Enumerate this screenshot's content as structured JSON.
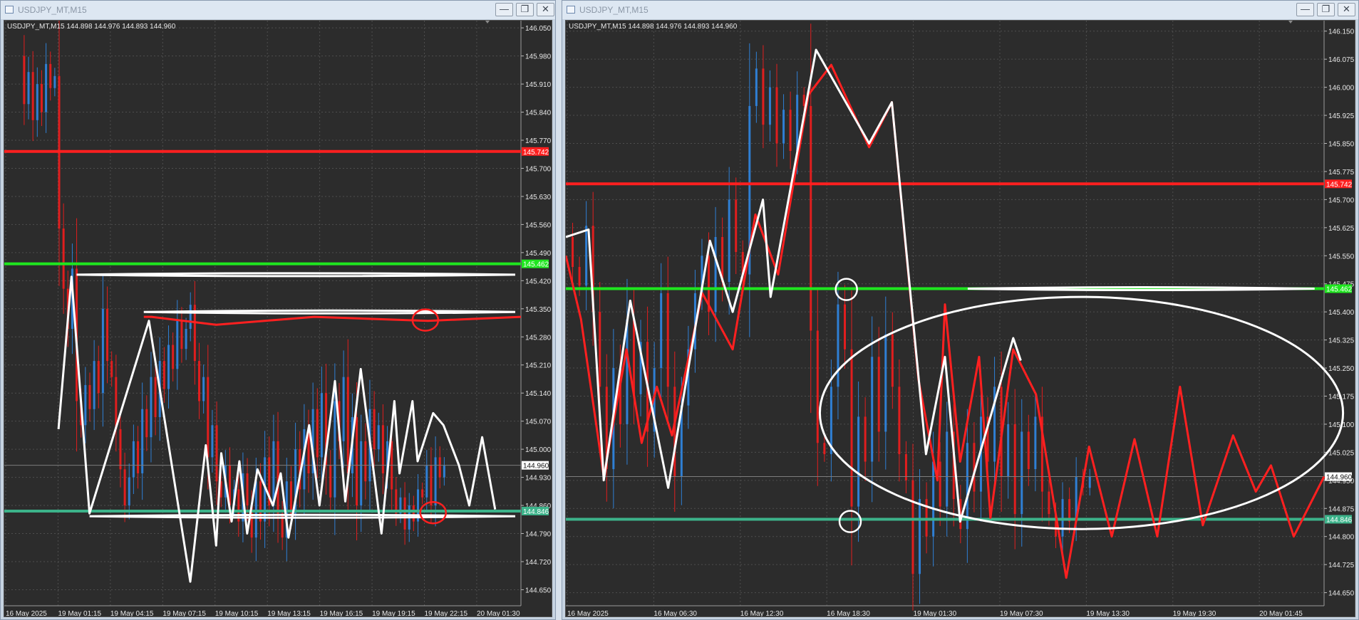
{
  "windows": [
    {
      "title": "USDJPY_MT,M15",
      "info": "USDJPY_MT,M15  144.898 144.976 144.893 144.960",
      "minimize": "—",
      "restore": "❐",
      "close": "✕",
      "chart_data": {
        "type": "candlestick",
        "ylim": [
          144.61,
          146.068
        ],
        "yticks": [
          "146.050",
          "145.980",
          "145.910",
          "145.840",
          "145.770",
          "145.700",
          "145.630",
          "145.560",
          "145.490",
          "145.420",
          "145.350",
          "145.280",
          "145.210",
          "145.140",
          "145.070",
          "145.000",
          "144.930",
          "144.860",
          "144.790",
          "144.720",
          "144.650"
        ],
        "xticks": [
          "16 May 2025",
          "19 May 01:15",
          "19 May 04:15",
          "19 May 07:15",
          "19 May 10:15",
          "19 May 13:15",
          "19 May 16:15",
          "19 May 19:15",
          "19 May 22:15",
          "20 May 01:30"
        ],
        "hlines": [
          {
            "price": 145.742,
            "label": "145.742",
            "color": "#ff1f1f"
          },
          {
            "price": 145.462,
            "label": "145.462",
            "color": "#1fe61f"
          },
          {
            "price": 144.846,
            "label": "144.846",
            "color": "#3cb38a"
          }
        ],
        "current": {
          "price": 144.96,
          "label": "144.960"
        },
        "price_path": [
          145.98,
          145.86,
          145.94,
          145.82,
          145.91,
          145.84,
          145.96,
          145.9,
          145.93,
          145.55,
          145.4,
          145.3,
          145.45,
          145.12,
          145.06,
          145.16,
          145.1,
          145.22,
          145.14,
          145.35,
          145.22,
          145.18,
          145.05,
          144.95,
          144.86,
          144.93,
          145.02,
          144.94,
          145.1,
          145.03,
          145.18,
          145.08,
          145.22,
          145.15,
          145.26,
          145.2,
          145.32,
          145.25,
          145.3,
          145.36,
          145.22,
          145.12,
          145.18,
          144.98,
          145.06,
          144.92,
          144.88,
          144.96,
          144.86,
          144.9,
          144.82,
          144.94,
          144.86,
          144.78,
          144.92,
          144.82,
          144.98,
          144.86,
          145.02,
          144.84,
          144.78,
          144.92,
          144.84,
          145.0,
          144.9,
          145.05,
          144.94,
          145.1,
          144.98,
          145.14,
          144.96,
          144.88,
          145.12,
          145.02,
          145.18,
          144.94,
          145.08,
          144.86,
          145.02,
          144.92,
          145.1,
          145.0,
          145.06,
          144.94,
          145.02,
          144.9,
          144.84,
          144.88,
          144.8,
          144.86,
          144.82,
          144.9,
          144.88,
          144.96,
          144.86,
          144.98,
          144.93,
          144.96
        ],
        "candle_span": [
          0.03,
          0.86
        ],
        "drawings": {
          "zigzag": [
            [
              0.105,
              145.05
            ],
            [
              0.13,
              145.43
            ],
            [
              0.165,
              144.84
            ],
            [
              0.28,
              145.32
            ],
            [
              0.36,
              144.67
            ],
            [
              0.39,
              145.01
            ],
            [
              0.41,
              144.76
            ],
            [
              0.42,
              144.99
            ],
            [
              0.44,
              144.82
            ],
            [
              0.455,
              144.97
            ],
            [
              0.47,
              144.79
            ],
            [
              0.49,
              144.95
            ],
            [
              0.52,
              144.86
            ],
            [
              0.535,
              144.94
            ],
            [
              0.55,
              144.78
            ],
            [
              0.59,
              145.06
            ],
            [
              0.61,
              144.86
            ],
            [
              0.64,
              145.17
            ],
            [
              0.66,
              144.87
            ],
            [
              0.69,
              145.2
            ],
            [
              0.73,
              144.79
            ],
            [
              0.755,
              145.12
            ],
            [
              0.765,
              144.94
            ],
            [
              0.79,
              145.12
            ],
            [
              0.8,
              144.97
            ],
            [
              0.83,
              145.09
            ],
            [
              0.85,
              145.06
            ],
            [
              0.88,
              144.96
            ],
            [
              0.9,
              144.86
            ],
            [
              0.925,
              145.03
            ],
            [
              0.95,
              144.85
            ]
          ],
          "zigzag_red": [
            [
              0.27,
              145.33
            ],
            [
              0.285,
              145.33
            ],
            [
              0.41,
              145.31
            ],
            [
              0.6,
              145.33
            ],
            [
              0.82,
              145.32
            ],
            [
              1.0,
              145.33
            ]
          ],
          "white_bands": [
            [
              0.14,
              145.435,
              1.0
            ],
            [
              0.27,
              145.342,
              1.0
            ],
            [
              0.165,
              144.833,
              1.0
            ]
          ],
          "red_circles": [
            [
              0.815,
              145.322
            ],
            [
              0.83,
              144.842
            ]
          ]
        }
      }
    },
    {
      "title": "USDJPY_MT,M15",
      "info": "USDJPY_MT,M15  144.898 144.976 144.893 144.960",
      "minimize": "—",
      "restore": "❐",
      "close": "✕",
      "chart_data": {
        "type": "candlestick",
        "ylim": [
          144.615,
          146.178
        ],
        "yticks": [
          "146.150",
          "146.075",
          "146.000",
          "145.925",
          "145.850",
          "145.775",
          "145.700",
          "145.625",
          "145.550",
          "145.475",
          "145.400",
          "145.325",
          "145.250",
          "145.175",
          "145.100",
          "145.025",
          "144.950",
          "144.875",
          "144.800",
          "144.725",
          "144.650"
        ],
        "xticks": [
          "16 May 2025",
          "16 May 06:30",
          "16 May 12:30",
          "16 May 18:30",
          "19 May 01:30",
          "19 May 07:30",
          "19 May 13:30",
          "19 May 19:30",
          "20 May 01:45"
        ],
        "hlines": [
          {
            "price": 145.742,
            "label": "145.742",
            "color": "#ff1f1f"
          },
          {
            "price": 145.462,
            "label": "145.462",
            "color": "#1fe61f"
          },
          {
            "price": 144.846,
            "label": "144.846",
            "color": "#3cb38a"
          }
        ],
        "current": {
          "price": 144.96,
          "label": "144.960"
        },
        "price_path": [
          145.6,
          145.52,
          145.47,
          145.63,
          145.4,
          145.2,
          144.98,
          145.25,
          145.1,
          145.38,
          145.18,
          145.32,
          145.08,
          145.25,
          145.45,
          145.2,
          144.96,
          145.15,
          145.3,
          145.45,
          145.55,
          145.4,
          145.6,
          145.48,
          145.7,
          145.56,
          145.5,
          145.95,
          146.05,
          145.9,
          146.0,
          145.85,
          145.94,
          145.83,
          145.98,
          145.95,
          145.35,
          145.05,
          145.02,
          145.2,
          145.42,
          145.3,
          144.88,
          145.12,
          145.0,
          145.28,
          145.08,
          145.34,
          145.2,
          145.02,
          144.95,
          144.7,
          144.9,
          144.8,
          145.0,
          144.88,
          145.08,
          144.9,
          144.82,
          145.05,
          144.92,
          145.12,
          145.0,
          145.2,
          144.96,
          145.1,
          144.86,
          145.08,
          144.98,
          145.12,
          144.92,
          144.86,
          144.8,
          144.9,
          144.84,
          144.96,
          144.93,
          144.96
        ],
        "candle_span": [
          0.0,
          0.7
        ],
        "drawings": {
          "zigzag": [
            [
              0.0,
              145.6
            ],
            [
              0.03,
              145.62
            ],
            [
              0.05,
              144.95
            ],
            [
              0.085,
              145.43
            ],
            [
              0.135,
              144.93
            ],
            [
              0.19,
              145.59
            ],
            [
              0.22,
              145.4
            ],
            [
              0.26,
              145.7
            ],
            [
              0.27,
              145.44
            ],
            [
              0.33,
              146.1
            ],
            [
              0.4,
              145.85
            ],
            [
              0.43,
              145.96
            ],
            [
              0.475,
              145.02
            ],
            [
              0.5,
              145.28
            ],
            [
              0.52,
              144.84
            ],
            [
              0.59,
              145.33
            ],
            [
              0.6,
              145.27
            ]
          ],
          "zigzag_red": [
            [
              0.0,
              145.55
            ],
            [
              0.02,
              145.38
            ],
            [
              0.05,
              144.96
            ],
            [
              0.08,
              145.3
            ],
            [
              0.1,
              145.05
            ],
            [
              0.12,
              145.2
            ],
            [
              0.14,
              145.07
            ],
            [
              0.18,
              145.45
            ],
            [
              0.22,
              145.3
            ],
            [
              0.25,
              145.66
            ],
            [
              0.28,
              145.5
            ],
            [
              0.32,
              145.98
            ],
            [
              0.35,
              146.06
            ],
            [
              0.4,
              145.84
            ],
            [
              0.43,
              145.96
            ],
            [
              0.465,
              145.22
            ],
            [
              0.49,
              144.95
            ],
            [
              0.5,
              145.42
            ],
            [
              0.52,
              145.0
            ],
            [
              0.545,
              145.28
            ],
            [
              0.56,
              144.85
            ],
            [
              0.59,
              145.3
            ],
            [
              0.62,
              145.18
            ],
            [
              0.66,
              144.69
            ],
            [
              0.69,
              145.04
            ],
            [
              0.72,
              144.8
            ],
            [
              0.75,
              145.06
            ],
            [
              0.78,
              144.8
            ],
            [
              0.81,
              145.2
            ],
            [
              0.84,
              144.83
            ],
            [
              0.88,
              145.07
            ],
            [
              0.91,
              144.92
            ],
            [
              0.93,
              144.99
            ],
            [
              0.96,
              144.8
            ],
            [
              1.0,
              144.96
            ]
          ],
          "white_bands": [
            [
              0.53,
              145.462,
              0.995
            ]
          ],
          "white_circles": [
            [
              0.37,
              145.46
            ],
            [
              0.375,
              144.84
            ]
          ],
          "ellipse": {
            "cx": 0.68,
            "cy": 145.13,
            "rx": 0.345,
            "ry_price": 0.31
          }
        }
      }
    }
  ],
  "colors": {
    "bull": "#2f7fd4",
    "bear": "#e01e1e",
    "grid": "#4e4e4e",
    "axis_text": "#e8e8e8",
    "bg": "#2c2c2c"
  }
}
